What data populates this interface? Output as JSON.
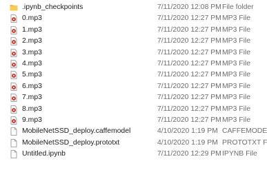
{
  "files": [
    {
      "name": ".ipynb_checkpoints",
      "date": "7/11/2020 12:08 PM",
      "type": "File folder",
      "icon": "folder-icon"
    },
    {
      "name": "0.mp3",
      "date": "7/11/2020 12:27 PM",
      "type": "MP3 File",
      "icon": "audio-file-icon"
    },
    {
      "name": "1.mp3",
      "date": "7/11/2020 12:27 PM",
      "type": "MP3 File",
      "icon": "audio-file-icon"
    },
    {
      "name": "2.mp3",
      "date": "7/11/2020 12:27 PM",
      "type": "MP3 File",
      "icon": "audio-file-icon"
    },
    {
      "name": "3.mp3",
      "date": "7/11/2020 12:27 PM",
      "type": "MP3 File",
      "icon": "audio-file-icon"
    },
    {
      "name": "4.mp3",
      "date": "7/11/2020 12:27 PM",
      "type": "MP3 File",
      "icon": "audio-file-icon"
    },
    {
      "name": "5.mp3",
      "date": "7/11/2020 12:27 PM",
      "type": "MP3 File",
      "icon": "audio-file-icon"
    },
    {
      "name": "6.mp3",
      "date": "7/11/2020 12:27 PM",
      "type": "MP3 File",
      "icon": "audio-file-icon"
    },
    {
      "name": "7.mp3",
      "date": "7/11/2020 12:27 PM",
      "type": "MP3 File",
      "icon": "audio-file-icon"
    },
    {
      "name": "8.mp3",
      "date": "7/11/2020 12:27 PM",
      "type": "MP3 File",
      "icon": "audio-file-icon"
    },
    {
      "name": "9.mp3",
      "date": "7/11/2020 12:27 PM",
      "type": "MP3 File",
      "icon": "audio-file-icon"
    },
    {
      "name": "MobileNetSSD_deploy.caffemodel",
      "date": "4/10/2020 1:19 PM",
      "type": "CAFFEMODEL",
      "icon": "blank-file-icon"
    },
    {
      "name": "MobileNetSSD_deploy.prototxt",
      "date": "4/10/2020 1:19 PM",
      "type": "PROTOTXT File",
      "icon": "blank-file-icon"
    },
    {
      "name": "Untitled.ipynb",
      "date": "7/11/2020 12:29 PM",
      "type": "IPYNB File",
      "icon": "blank-file-icon"
    }
  ],
  "colors": {
    "folder": "#f6cd5a",
    "folder_dark": "#e3b23c",
    "audio_badge": "#c8402f",
    "text_secondary": "#6d6d6d"
  }
}
